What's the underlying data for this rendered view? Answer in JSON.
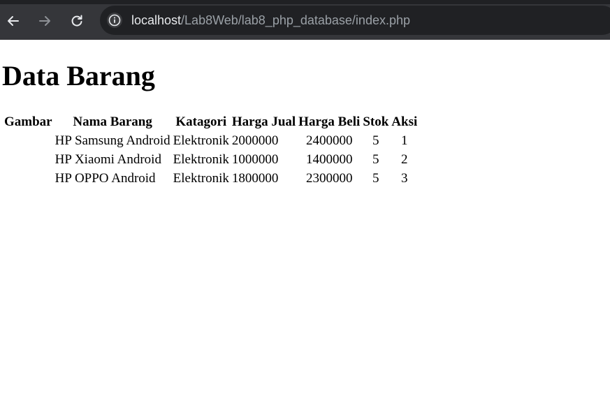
{
  "browser": {
    "url_host": "localhost",
    "url_path": "/Lab8Web/lab8_php_database/index.php",
    "icons": [
      "back-arrow-icon",
      "forward-arrow-icon",
      "reload-icon",
      "site-info-icon"
    ]
  },
  "page": {
    "title": "Data Barang"
  },
  "table": {
    "headers": {
      "gambar": "Gambar",
      "nama": "Nama Barang",
      "kategori": "Katagori",
      "harga_jual": "Harga Jual",
      "harga_beli": "Harga Beli",
      "stok": "Stok",
      "aksi": "Aksi"
    },
    "rows": [
      {
        "gambar": "",
        "nama": "HP Samsung Android",
        "kategori": "Elektronik",
        "harga_jual": "2000000",
        "harga_beli": "2400000",
        "stok": "5",
        "aksi": "1"
      },
      {
        "gambar": "",
        "nama": "HP Xiaomi Android",
        "kategori": "Elektronik",
        "harga_jual": "1000000",
        "harga_beli": "1400000",
        "stok": "5",
        "aksi": "2"
      },
      {
        "gambar": "",
        "nama": "HP OPPO Android",
        "kategori": "Elektronik",
        "harga_jual": "1800000",
        "harga_beli": "2300000",
        "stok": "5",
        "aksi": "3"
      }
    ]
  }
}
